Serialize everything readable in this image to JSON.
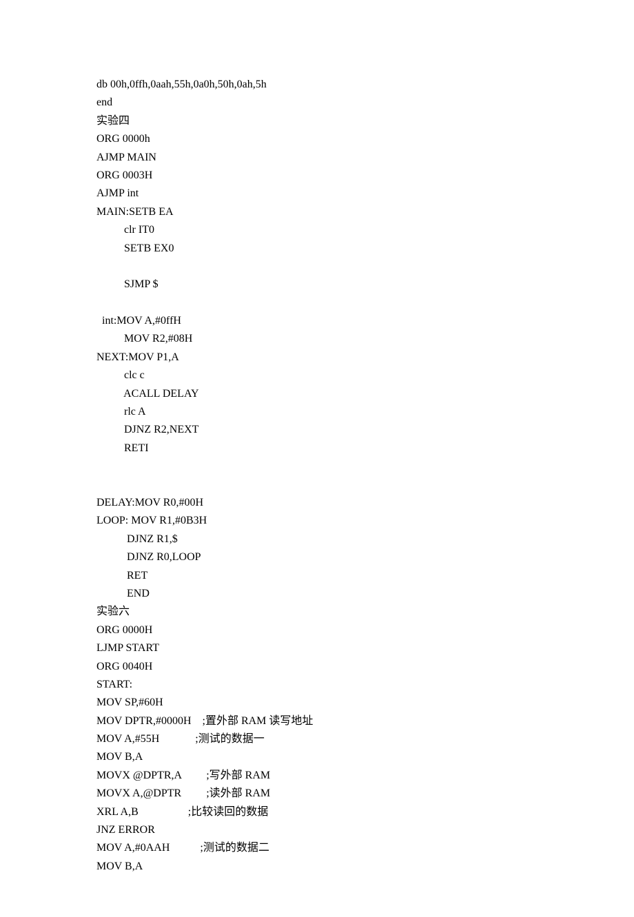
{
  "lines": [
    "db 00h,0ffh,0aah,55h,0a0h,50h,0ah,5h",
    "end",
    "实验四",
    "ORG 0000h",
    "AJMP MAIN",
    "ORG 0003H",
    "AJMP int",
    "MAIN:SETB EA",
    "          clr IT0",
    "          SETB EX0",
    "",
    "          SJMP $",
    "",
    "  int:MOV A,#0ffH",
    "          MOV R2,#08H",
    "NEXT:MOV P1,A",
    "          clc c",
    "          ACALL DELAY",
    "          rlc A",
    "          DJNZ R2,NEXT",
    "          RETI",
    "",
    "",
    "DELAY:MOV R0,#00H",
    "LOOP: MOV R1,#0B3H",
    "           DJNZ R1,$",
    "           DJNZ R0,LOOP",
    "           RET",
    "           END",
    "实验六",
    "ORG 0000H",
    "LJMP START",
    "ORG 0040H",
    "START:",
    "MOV SP,#60H",
    "MOV DPTR,#0000H    ;置外部 RAM 读写地址",
    "MOV A,#55H             ;测试的数据一",
    "MOV B,A",
    "MOVX @DPTR,A         ;写外部 RAM",
    "MOVX A,@DPTR         ;读外部 RAM",
    "XRL A,B                  ;比较读回的数据",
    "JNZ ERROR",
    "MOV A,#0AAH           ;测试的数据二",
    "MOV B,A"
  ]
}
